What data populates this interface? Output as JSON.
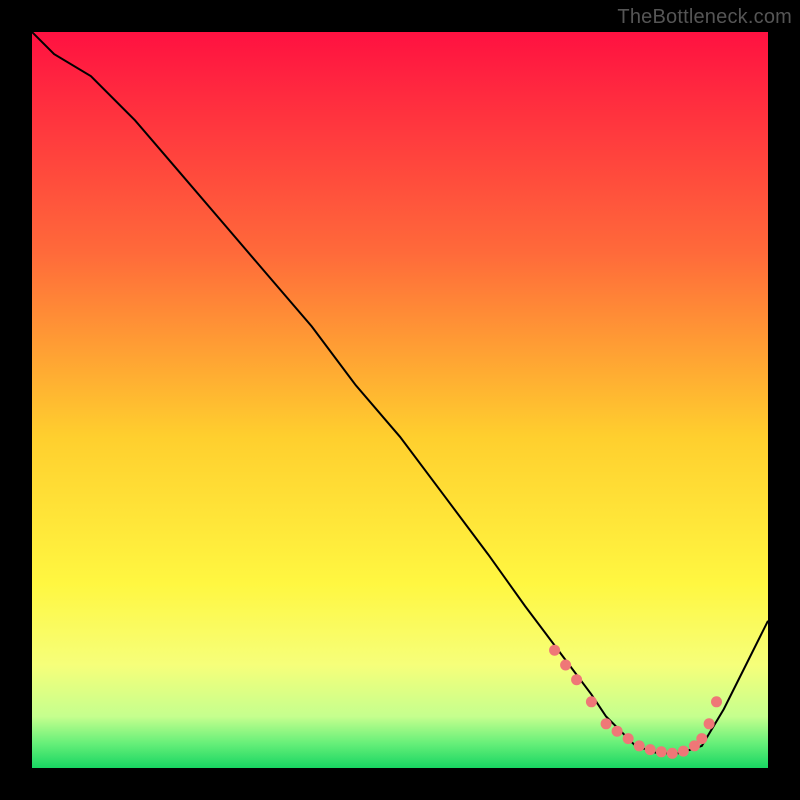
{
  "watermark": "TheBottleneck.com",
  "colors": {
    "frame_bg": "#000000",
    "curve_stroke": "#000000",
    "dot_fill": "#ef7777",
    "gradient_stops": [
      {
        "offset": 0.0,
        "color": "#ff1141"
      },
      {
        "offset": 0.3,
        "color": "#ff6a3a"
      },
      {
        "offset": 0.55,
        "color": "#ffcf2e"
      },
      {
        "offset": 0.75,
        "color": "#fff741"
      },
      {
        "offset": 0.86,
        "color": "#f6ff7a"
      },
      {
        "offset": 0.93,
        "color": "#c5ff8e"
      },
      {
        "offset": 0.965,
        "color": "#6af07a"
      },
      {
        "offset": 1.0,
        "color": "#18d662"
      }
    ]
  },
  "chart_data": {
    "type": "line",
    "title": "",
    "xlabel": "",
    "ylabel": "",
    "xlim": [
      0,
      100
    ],
    "ylim": [
      0,
      100
    ],
    "series": [
      {
        "name": "curve",
        "x": [
          0,
          3,
          8,
          14,
          20,
          26,
          32,
          38,
          44,
          50,
          56,
          62,
          67,
          70,
          73,
          76,
          78,
          80,
          82,
          85,
          88,
          91,
          94,
          97,
          100
        ],
        "y": [
          100,
          97,
          94,
          88,
          81,
          74,
          67,
          60,
          52,
          45,
          37,
          29,
          22,
          18,
          14,
          10,
          7,
          5,
          3,
          2,
          2,
          3,
          8,
          14,
          20
        ]
      }
    ],
    "markers": {
      "name": "dots",
      "x": [
        71,
        72.5,
        74,
        76,
        78,
        79.5,
        81,
        82.5,
        84,
        85.5,
        87,
        88.5,
        90,
        91,
        92,
        93
      ],
      "y": [
        16,
        14,
        12,
        9,
        6,
        5,
        4,
        3,
        2.5,
        2.2,
        2,
        2.3,
        3,
        4,
        6,
        9
      ]
    }
  }
}
